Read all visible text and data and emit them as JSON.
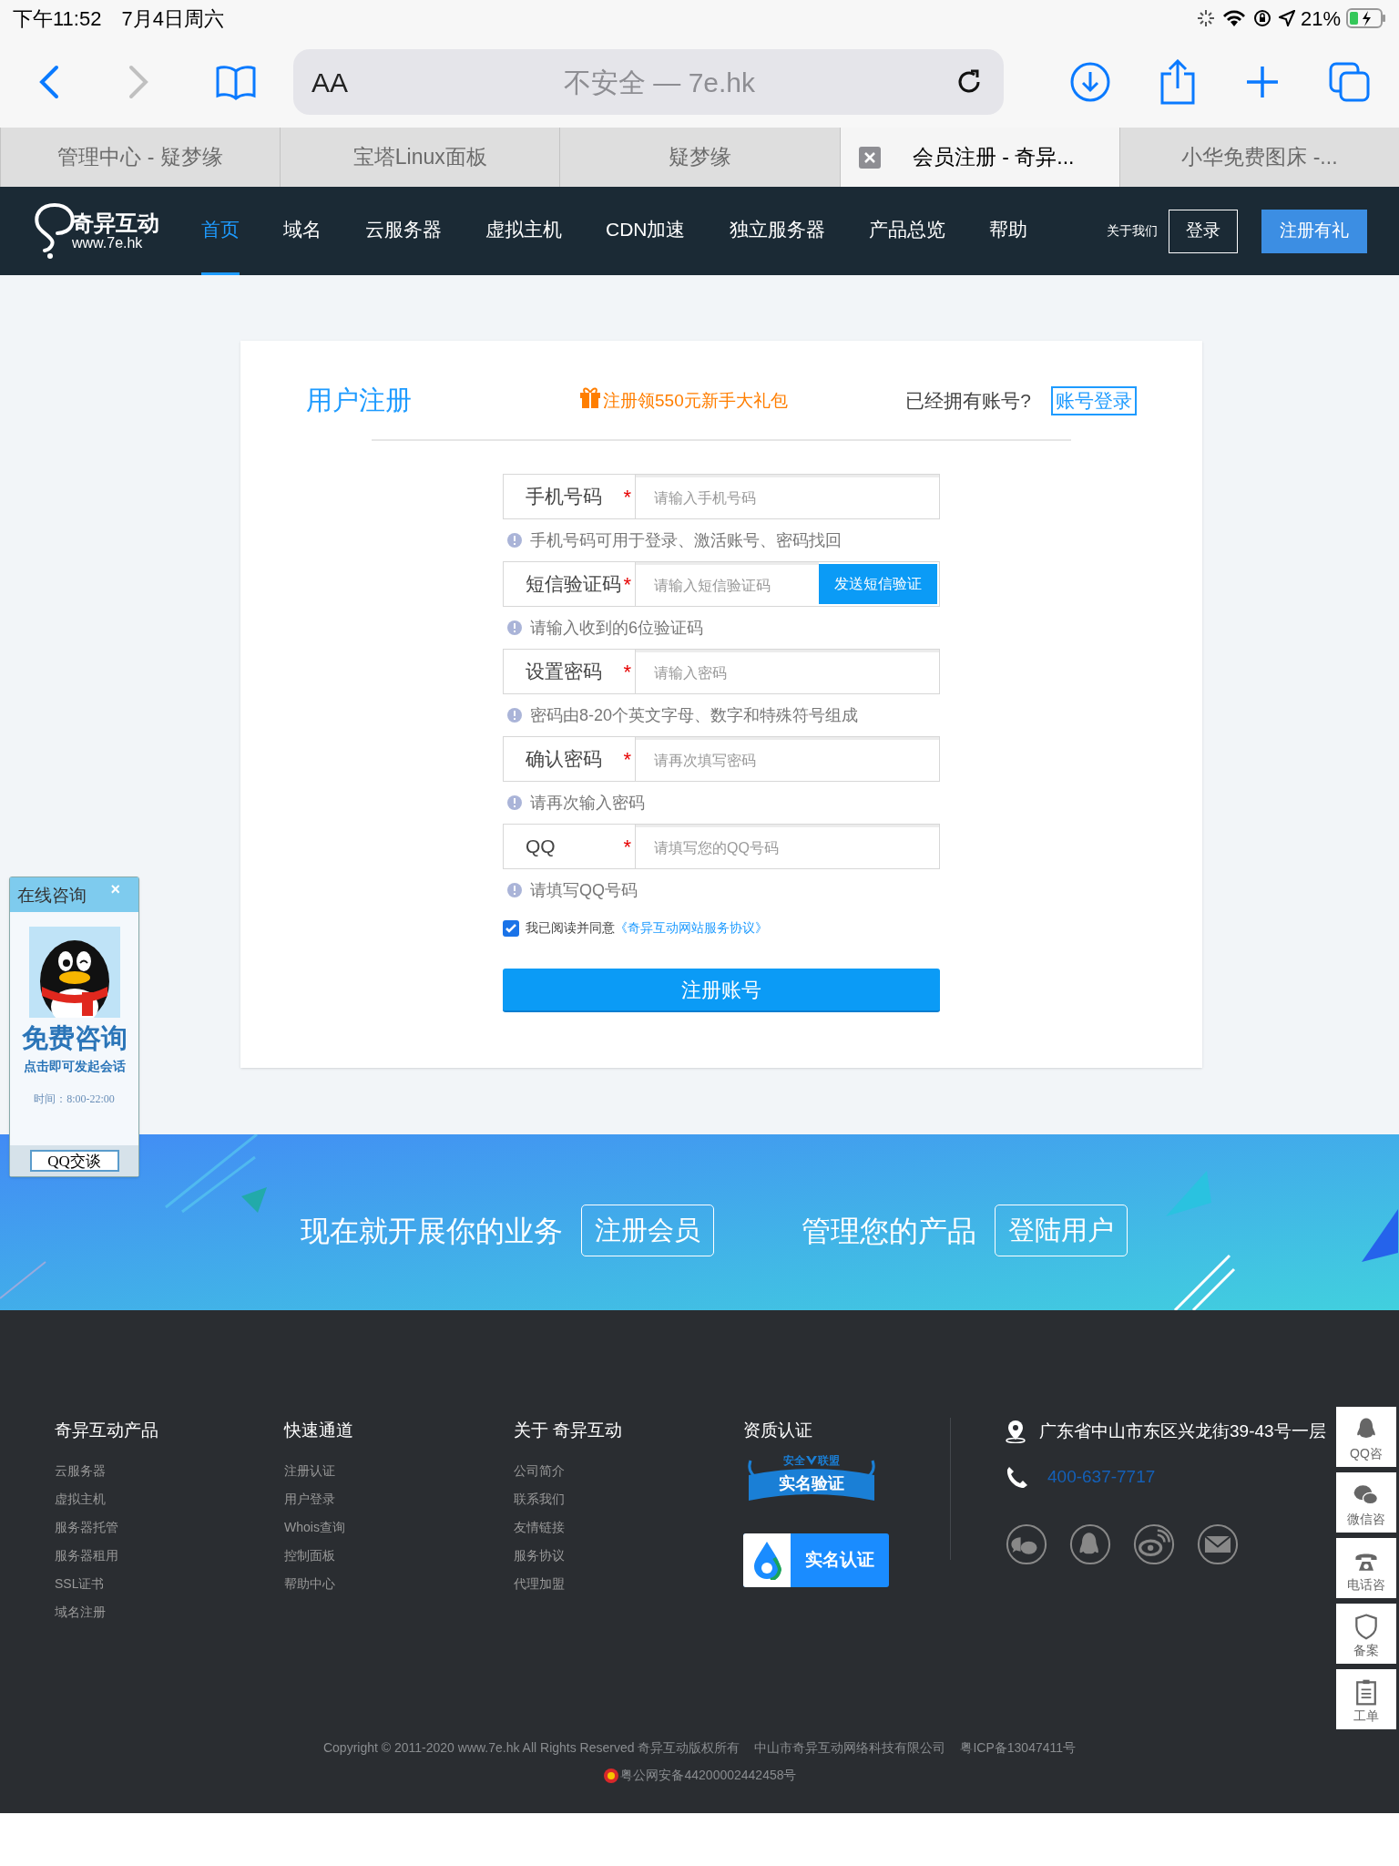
{
  "status_bar": {
    "time": "下午11:52",
    "date": "7月4日周六",
    "battery": "21%"
  },
  "browser": {
    "reader_label": "AA",
    "address": "不安全 — 7e.hk",
    "tabs": [
      {
        "title": "管理中心 - 疑梦缘",
        "selected": false
      },
      {
        "title": "宝塔Linux面板",
        "selected": false
      },
      {
        "title": "疑梦缘",
        "selected": false
      },
      {
        "title": "会员注册 - 奇异...",
        "selected": true
      },
      {
        "title": "小华免费图床 -...",
        "selected": false
      }
    ]
  },
  "site_nav": {
    "logo_text": "奇异互动",
    "logo_url": "www.7e.hk",
    "items": [
      {
        "label": "首页",
        "selected": true
      },
      {
        "label": "域名",
        "selected": false
      },
      {
        "label": "云服务器",
        "selected": false
      },
      {
        "label": "虚拟主机",
        "selected": false
      },
      {
        "label": "CDN加速",
        "selected": false
      },
      {
        "label": "独立服务器",
        "selected": false
      },
      {
        "label": "产品总览",
        "selected": false
      },
      {
        "label": "帮助",
        "selected": false
      }
    ],
    "about": "关于我们",
    "login": "登录",
    "register": "注册有礼"
  },
  "form": {
    "title": "用户注册",
    "promo": "注册领550元新手大礼包",
    "have_account": "已经拥有账号?",
    "login_link": "账号登录",
    "fields": [
      {
        "kind": "text",
        "label": "手机号码",
        "required": "*",
        "placeholder": "请输入手机号码",
        "hint": "手机号码可用于登录、激活账号、密码找回"
      },
      {
        "kind": "sms",
        "label": "短信验证码",
        "required": "*",
        "placeholder": "请输入短信验证码",
        "button": "发送短信验证",
        "hint": "请输入收到的6位验证码"
      },
      {
        "kind": "text",
        "label": "设置密码",
        "required": "*",
        "placeholder": "请输入密码",
        "hint": "密码由8-20个英文字母、数字和特殊符号组成"
      },
      {
        "kind": "text",
        "label": "确认密码",
        "required": "*",
        "placeholder": "请再次填写密码",
        "hint": "请再次输入密码"
      },
      {
        "kind": "text",
        "label": "QQ",
        "required": "*",
        "placeholder": "请填写您的QQ号码",
        "hint": "请填写QQ号码"
      }
    ],
    "agree": {
      "checked": true,
      "text": "我已阅读并同意",
      "link": "《奇异互动网站服务协议》"
    },
    "submit": "注册账号"
  },
  "chat_widget": {
    "title": "在线咨询",
    "close": "×",
    "headline": "免费咨询",
    "subline": "点击即可发起会话",
    "hours": "时间：8:00-22:00",
    "button": "QQ交谈"
  },
  "banner": {
    "slogan_1": "现在就开展你的业务",
    "button_1": "注册会员",
    "slogan_2": "管理您的产品",
    "button_2": "登陆用户"
  },
  "footer": {
    "columns": [
      {
        "title": "奇异互动产品",
        "links": [
          "云服务器",
          "虚拟主机",
          "服务器托管",
          "服务器租用",
          "SSL证书",
          "域名注册"
        ]
      },
      {
        "title": "快速通道",
        "links": [
          "注册认证",
          "用户登录",
          "Whois查询",
          "控制面板",
          "帮助中心"
        ]
      },
      {
        "title": "关于 奇异互动",
        "links": [
          "公司简介",
          "联系我们",
          "友情链接",
          "服务协议",
          "代理加盟"
        ]
      }
    ],
    "certification": {
      "title": "资质认证",
      "badge_1_top_left": "安全",
      "badge_1_top_right": "联盟",
      "badge_1": "实名验证",
      "badge_2": "实名认证"
    },
    "address": "广东省中山市东区兴龙街39-43号一层",
    "phone": "400-637-7717",
    "copyright": "Copyright © 2011-2020 www.7e.hk All Rights Reserved 奇异互动版权所有",
    "company": "中山市奇异互动网络科技有限公司",
    "icp": "粤ICP备13047411号",
    "police": "粤公网安备44200002442458号"
  },
  "side_tools": [
    {
      "kind": "qq",
      "label": "QQ咨"
    },
    {
      "kind": "wechat",
      "label": "微信咨"
    },
    {
      "kind": "phone",
      "label": "电话咨"
    },
    {
      "kind": "icp",
      "label": "备案"
    },
    {
      "kind": "ticket",
      "label": "工单"
    }
  ]
}
